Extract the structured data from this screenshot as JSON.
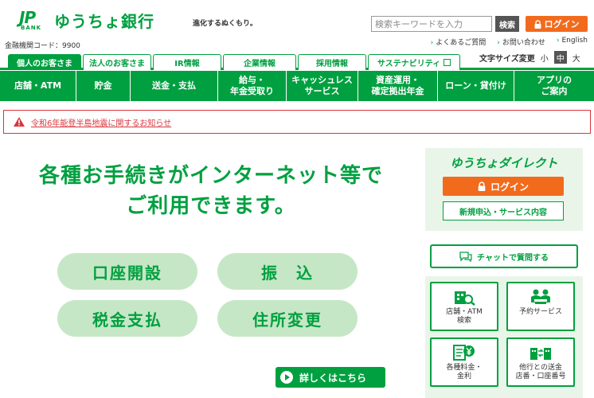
{
  "header": {
    "logo_mark": "JP",
    "logo_bank": "BANK",
    "bank_name": "ゆうちょ銀行",
    "tagline": "進化するぬくもり。",
    "bank_code": "金融機関コード：9900",
    "search": {
      "placeholder": "検索キーワードを入力",
      "button": "検索"
    },
    "login_label": "ログイン",
    "util_links": [
      "よくあるご質問",
      "お問い合わせ",
      "English"
    ]
  },
  "tabs": [
    {
      "label": "個人のお客さま",
      "active": true
    },
    {
      "label": "法人のお客さま",
      "active": false
    },
    {
      "label": "IR情報",
      "active": false
    },
    {
      "label": "企業情報",
      "active": false
    },
    {
      "label": "採用情報",
      "active": false
    },
    {
      "label": "サステナビリティ",
      "active": false
    }
  ],
  "font_size": {
    "label": "文字サイズ変更",
    "options": [
      "小",
      "中",
      "大"
    ],
    "selected": "中"
  },
  "main_nav": [
    "店舗・ATM",
    "貯金",
    "送金・支払",
    "給与・\n年金受取り",
    "キャッシュレス\nサービス",
    "資産運用・\n確定拠出年金",
    "ローン・貸付け",
    "アプリの\nご案内"
  ],
  "notice": {
    "text": "令和6年能登半島地震に関するお知らせ"
  },
  "hero": {
    "headline_line1": "各種お手続きがインターネット等で",
    "headline_line2": "ご利用できます。",
    "buttons": [
      "口座開設",
      "振　込",
      "税金支払",
      "住所変更"
    ],
    "more_label": "詳しくはこちら"
  },
  "sidebar": {
    "direct_title": "ゆうちょダイレクト",
    "direct_login": "ログイン",
    "direct_new": "新規申込・サービス内容",
    "chat_label": "チャットで質問する",
    "tiles": [
      {
        "label": "店舗・ATM\n検索",
        "icon": "store-search-icon"
      },
      {
        "label": "予約サービス",
        "icon": "reservation-icon"
      },
      {
        "label": "各種料金・\n金利",
        "icon": "fee-yen-icon"
      },
      {
        "label": "他行との送金\n店番・口座番号",
        "icon": "bank-transfer-icon"
      }
    ]
  },
  "colors": {
    "brand_green": "#00a040",
    "login_orange": "#f26b1d",
    "alert_red": "#d9363e",
    "pill_bg": "#c6e7c6"
  }
}
